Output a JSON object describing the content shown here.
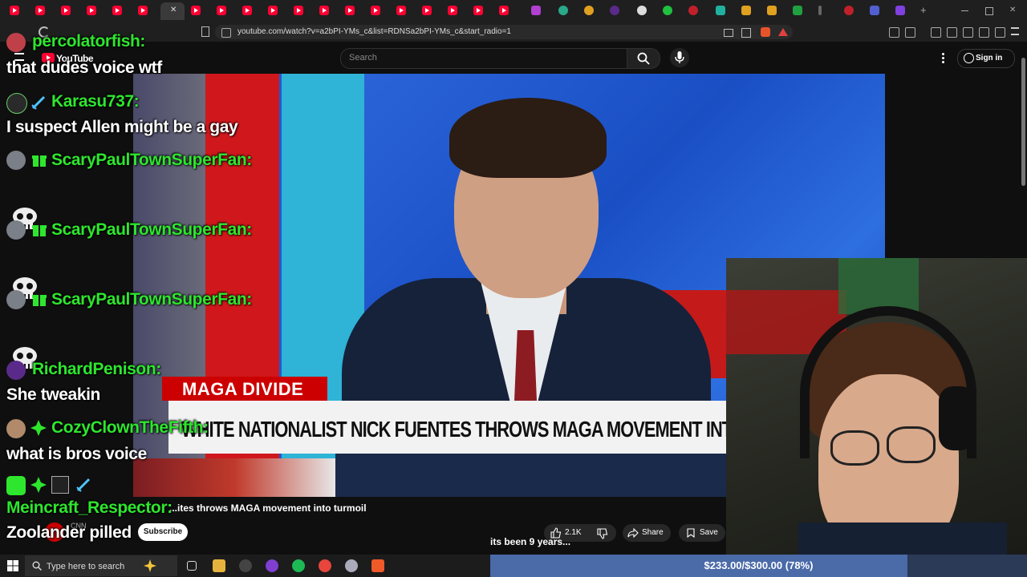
{
  "browser": {
    "url": "youtube.com/watch?v=a2bPI-YMs_c&list=RDNSa2bPI-YMs_c&start_radio=1",
    "close_tab_glyph": "✕",
    "new_tab_glyph": "+"
  },
  "youtube": {
    "logo_text": "YouTube",
    "search_placeholder": "Search",
    "sign_in_label": "Sign in",
    "video_title": "...ites throws MAGA movement into turmoil",
    "subscribe_label": "Subscribe",
    "likes": "2.1K",
    "share_label": "Share",
    "save_label": "Save",
    "channel_name": "CNN"
  },
  "video": {
    "tag": "MAGA DIVIDE",
    "headline": "WHITE NATIONALIST NICK FUENTES THROWS MAGA MOVEMENT INTO TURMOIL",
    "corner_text": "IN"
  },
  "chat": [
    {
      "user": "percolatorfish:",
      "message": "that dudes voice wtf"
    },
    {
      "user": "Karasu737:",
      "message": "I suspect Allen might be a gay"
    },
    {
      "user": "ScaryPaulTownSuperFan:",
      "message": ""
    },
    {
      "user": "ScaryPaulTownSuperFan:",
      "message": ""
    },
    {
      "user": "ScaryPaulTownSuperFan:",
      "message": ""
    },
    {
      "user": "RichardPenison:",
      "message": "She tweakin"
    },
    {
      "user": "CozyClownTheFifth:",
      "message": "what is bros voice"
    },
    {
      "user": "Meincraft_Respector:",
      "message": "Zoolander pilled"
    }
  ],
  "overlay": {
    "caption": "its been 9 years...",
    "goal_text": "$233.00/$300.00 (78%)",
    "goal_current": 233,
    "goal_target": 300
  },
  "taskbar": {
    "search_placeholder": "Type here to search"
  },
  "colors": {
    "chat_username": "#2ee62e",
    "youtube_red": "#ff0033",
    "cnn_red": "#cc0000"
  }
}
